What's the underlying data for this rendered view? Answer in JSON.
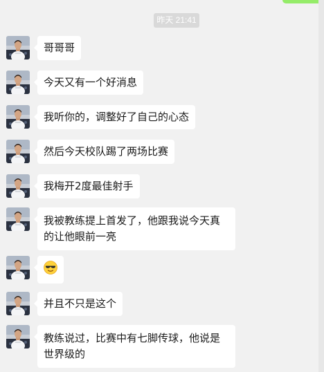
{
  "chat": {
    "timestamp": "昨天 21:41",
    "messages": [
      {
        "text": "哥哥哥"
      },
      {
        "text": "今天又有一个好消息"
      },
      {
        "text": "我听你的，调整好了自己的心态"
      },
      {
        "text": "然后今天校队踢了两场比赛"
      },
      {
        "text": "我梅开2度最佳射手"
      },
      {
        "text": "我被教练提上首发了，他跟我说今天真的让他眼前一亮"
      },
      {
        "emoji": "sunglasses-face"
      },
      {
        "text": "并且不只是这个"
      },
      {
        "text": "教练说过，比赛中有七脚传球，他说是世界级的"
      }
    ]
  },
  "colors": {
    "background": "#f1f1f1",
    "bubble": "#ffffff",
    "timestamp_bg": "#d9d9d9",
    "sent_bubble": "#95ec69"
  }
}
